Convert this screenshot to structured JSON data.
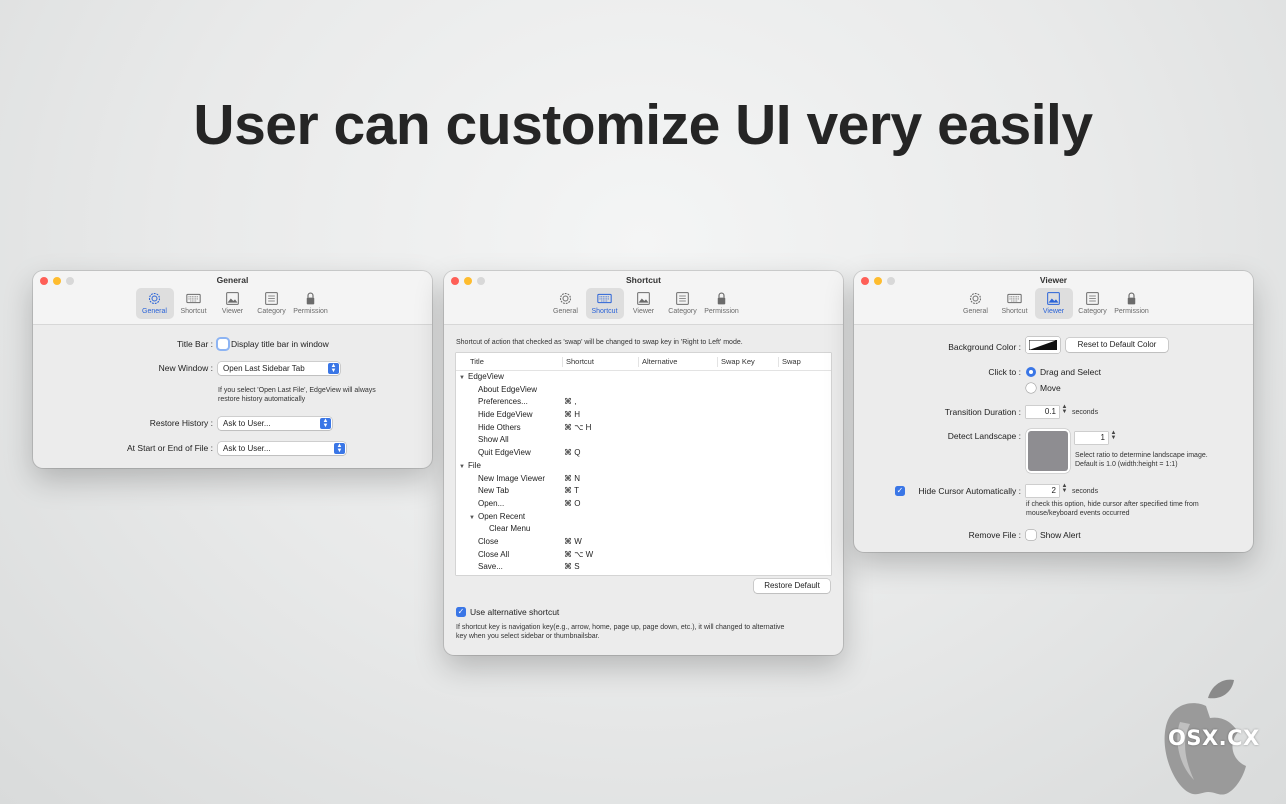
{
  "headline": "User can customize UI very easily",
  "tabs": [
    "General",
    "Shortcut",
    "Viewer",
    "Category",
    "Permission"
  ],
  "general": {
    "title": "General",
    "title_bar_label": "Title Bar :",
    "title_bar_checkbox": "Display title bar in window",
    "new_window_label": "New Window :",
    "new_window_value": "Open Last Sidebar Tab",
    "new_window_note_1": "If you select 'Open Last File', EdgeView will always",
    "new_window_note_2": "restore history automatically",
    "restore_history_label": "Restore History :",
    "restore_history_value": "Ask to User...",
    "start_end_label": "At Start or End of File :",
    "start_end_value": "Ask to User..."
  },
  "shortcut": {
    "title": "Shortcut",
    "description": "Shortcut of action that checked as 'swap' will be changed to swap key in 'Right to Left' mode.",
    "columns": [
      "Title",
      "Shortcut",
      "Alternative",
      "Swap Key",
      "Swap"
    ],
    "rows": [
      {
        "title": "EdgeView",
        "shortcut": "",
        "level": 0,
        "group": true
      },
      {
        "title": "About EdgeView",
        "shortcut": "",
        "level": 1
      },
      {
        "title": "Preferences...",
        "shortcut": "⌘ ,",
        "level": 1
      },
      {
        "title": "Hide EdgeView",
        "shortcut": "⌘ H",
        "level": 1
      },
      {
        "title": "Hide Others",
        "shortcut": "⌘ ⌥ H",
        "level": 1
      },
      {
        "title": "Show All",
        "shortcut": "",
        "level": 1
      },
      {
        "title": "Quit EdgeView",
        "shortcut": "⌘ Q",
        "level": 1
      },
      {
        "title": "File",
        "shortcut": "",
        "level": 0,
        "group": true
      },
      {
        "title": "New Image Viewer",
        "shortcut": "⌘ N",
        "level": 1
      },
      {
        "title": "New Tab",
        "shortcut": "⌘ T",
        "level": 1
      },
      {
        "title": "Open...",
        "shortcut": "⌘ O",
        "level": 1
      },
      {
        "title": "Open Recent",
        "shortcut": "",
        "level": 1,
        "group": true
      },
      {
        "title": "Clear Menu",
        "shortcut": "",
        "level": 2
      },
      {
        "title": "Close",
        "shortcut": "⌘ W",
        "level": 1
      },
      {
        "title": "Close All",
        "shortcut": "⌘ ⌥ W",
        "level": 1
      },
      {
        "title": "Save...",
        "shortcut": "⌘ S",
        "level": 1
      }
    ],
    "restore_default": "Restore Default",
    "alt_checkbox": "Use alternative shortcut",
    "alt_note_1": "If shortcut key is navigation key(e.g., arrow, home, page up, page down, etc.), it will changed to alternative",
    "alt_note_2": "key when you select sidebar or thumbnailsbar."
  },
  "viewer": {
    "title": "Viewer",
    "bg_color_label": "Background Color :",
    "reset_color": "Reset to Default Color",
    "click_to_label": "Click to :",
    "click_options": [
      "Drag and Select",
      "Move"
    ],
    "transition_label": "Transition Duration :",
    "transition_value": "0.1",
    "seconds": "seconds",
    "detect_label": "Detect Landscape :",
    "detect_value": "1",
    "detect_note_1": "Select ratio to determine landscape image.",
    "detect_note_2": "Default is 1.0 (width:height = 1:1)",
    "hide_cursor_label": "Hide Cursor Automatically :",
    "hide_cursor_value": "2",
    "hide_cursor_note_1": "if check this option, hide cursor after specified time from",
    "hide_cursor_note_2": "mouse/keyboard events occurred",
    "remove_file_label": "Remove File :",
    "show_alert": "Show Alert"
  },
  "watermark": "OSX.CX",
  "colors": {
    "accent": "#3a76e6",
    "swatch": "#8e8d91"
  }
}
